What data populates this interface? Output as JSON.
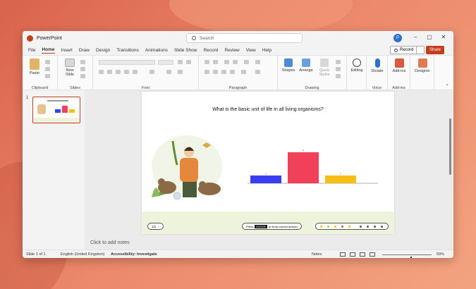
{
  "app": {
    "name": "PowerPoint",
    "avatar_initial": "P"
  },
  "search": {
    "placeholder": "Search"
  },
  "window_controls": {
    "minimize": "–",
    "maximize": "▢",
    "close": "✕"
  },
  "menu": {
    "items": [
      "File",
      "Home",
      "Insert",
      "Draw",
      "Design",
      "Transitions",
      "Animations",
      "Slide Show",
      "Record",
      "Review",
      "View",
      "Help"
    ],
    "active": "Home",
    "record_label": "Record",
    "share_label": "Share"
  },
  "ribbon": {
    "clipboard": {
      "label": "Clipboard",
      "paste": "Paste"
    },
    "slides": {
      "label": "Slides",
      "new_slide_line1": "New",
      "new_slide_line2": "Slide"
    },
    "font": {
      "label": "Font"
    },
    "paragraph": {
      "label": "Paragraph"
    },
    "drawing": {
      "label": "Drawing",
      "shapes": "Shapes",
      "arrange": "Arrange",
      "quick_styles_line1": "Quick",
      "quick_styles_line2": "Styles"
    },
    "editing": {
      "label": "Editing"
    },
    "voice": {
      "label": "Voice",
      "dictate": "Dictate"
    },
    "addins": {
      "label": "Add-ins",
      "addins_btn": "Add-ins"
    },
    "designer": {
      "designer_btn": "Designer"
    }
  },
  "thumbnail": {
    "number": "1"
  },
  "slide": {
    "question": "What is the basic unit of life in all living organisms?",
    "pager": "1/1",
    "enter_hint_prefix": "Press",
    "enter_key": "ENTER",
    "enter_hint_suffix": "to show correct answer"
  },
  "chart_data": {
    "type": "bar",
    "categories": [
      "",
      "",
      ""
    ],
    "values": [
      1,
      4,
      1
    ],
    "colors": [
      "#3b3ef0",
      "#f0405a",
      "#f7be16"
    ]
  },
  "notes": {
    "placeholder": "Click to add notes"
  },
  "status": {
    "slide_info": "Slide 1 of 1",
    "language": "English (United Kingdom)",
    "accessibility": "Accessibility: Investigate",
    "notes_btn": "Notes",
    "zoom": "59%",
    "zoom_fraction": 0.59
  }
}
